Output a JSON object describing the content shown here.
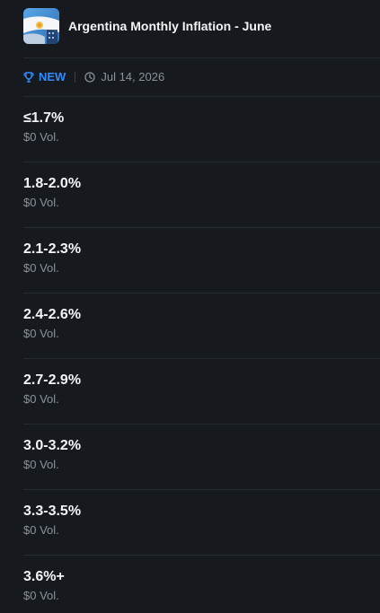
{
  "header": {
    "title": "Argentina Monthly Inflation - June",
    "thumbnail_icon": "argentina-flag-icon"
  },
  "meta": {
    "badge": "NEW",
    "badge_icon": "trophy-icon",
    "badge_color": "#2f8cff",
    "date": "Jul 14, 2026",
    "date_icon": "clock-icon"
  },
  "outcomes": [
    {
      "label": "≤1.7%",
      "volume": "$0 Vol."
    },
    {
      "label": "1.8-2.0%",
      "volume": "$0 Vol."
    },
    {
      "label": "2.1-2.3%",
      "volume": "$0 Vol."
    },
    {
      "label": "2.4-2.6%",
      "volume": "$0 Vol."
    },
    {
      "label": "2.7-2.9%",
      "volume": "$0 Vol."
    },
    {
      "label": "3.0-3.2%",
      "volume": "$0 Vol."
    },
    {
      "label": "3.3-3.5%",
      "volume": "$0 Vol."
    },
    {
      "label": "3.6%+",
      "volume": "$0 Vol."
    }
  ],
  "colors": {
    "background": "#16191e",
    "divider": "#262a31",
    "text_primary": "#f3f4f6",
    "text_secondary": "#8c919a"
  }
}
